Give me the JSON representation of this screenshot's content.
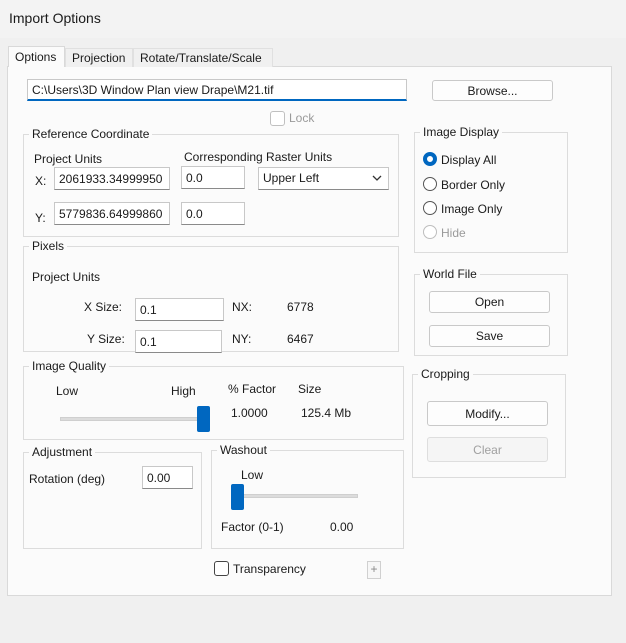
{
  "window": {
    "title": "Import Options"
  },
  "tabs": [
    {
      "label": "Options"
    },
    {
      "label": "Projection"
    },
    {
      "label": "Rotate/Translate/Scale"
    }
  ],
  "file": {
    "path": "C:\\Users\\3D Window Plan view Drape\\M21.tif",
    "browse_label": "Browse...",
    "lock_label": "Lock"
  },
  "reference": {
    "legend": "Reference Coordinate",
    "project_units_label": "Project Units",
    "raster_units_label": "Corresponding Raster Units",
    "x_label": "X:",
    "y_label": "Y:",
    "x_value": "2061933.34999950",
    "y_value": "5779836.64999860",
    "raster_x": "0.0",
    "raster_y": "0.0",
    "anchor_selected": "Upper Left"
  },
  "pixels": {
    "legend": "Pixels",
    "project_units_label": "Project Units",
    "x_size_label": "X Size:",
    "y_size_label": "Y Size:",
    "x_size": "0.1",
    "y_size": "0.1",
    "nx_label": "NX:",
    "ny_label": "NY:",
    "nx": "6778",
    "ny": "6467"
  },
  "image_display": {
    "legend": "Image Display",
    "options": [
      {
        "label": "Display All",
        "checked": true,
        "disabled": false
      },
      {
        "label": "Border Only",
        "checked": false,
        "disabled": false
      },
      {
        "label": "Image Only",
        "checked": false,
        "disabled": false
      },
      {
        "label": "Hide",
        "checked": false,
        "disabled": true
      }
    ]
  },
  "world_file": {
    "legend": "World File",
    "open_label": "Open",
    "save_label": "Save"
  },
  "image_quality": {
    "legend": "Image Quality",
    "low_label": "Low",
    "high_label": "High",
    "factor_label": "% Factor",
    "size_label": "Size",
    "factor_value": "1.0000",
    "size_value": "125.4 Mb",
    "slider_level": 1.0
  },
  "cropping": {
    "legend": "Cropping",
    "modify_label": "Modify...",
    "clear_label": "Clear"
  },
  "adjustment": {
    "legend": "Adjustment",
    "rotation_label": "Rotation (deg)",
    "rotation_value": "0.00"
  },
  "washout": {
    "legend": "Washout",
    "low_label": "Low",
    "factor_label": "Factor (0-1)",
    "factor_value": "0.00",
    "slider_level": 0.0
  },
  "transparency": {
    "label": "Transparency",
    "expand_symbol": "+"
  },
  "colors": {
    "accent": "#0067c0"
  }
}
